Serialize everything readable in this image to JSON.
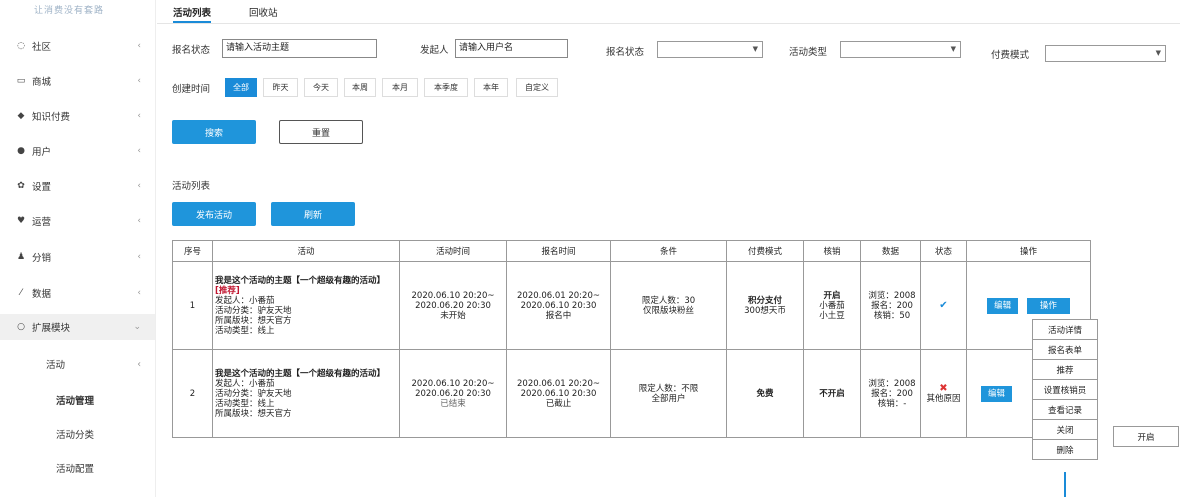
{
  "brand": {
    "logo_text": "让消费没有套路"
  },
  "sidebar": {
    "items": [
      {
        "icon": "comment-icon",
        "glyph": "◌",
        "label": "社区"
      },
      {
        "icon": "laptop-icon",
        "glyph": "▭",
        "label": "商城"
      },
      {
        "icon": "graduation-cap-icon",
        "glyph": "◆",
        "label": "知识付费"
      },
      {
        "icon": "user-icon",
        "glyph": "●",
        "label": "用户"
      },
      {
        "icon": "gear-icon",
        "glyph": "✿",
        "label": "设置"
      },
      {
        "icon": "heartbeat-icon",
        "glyph": "♥",
        "label": "运营"
      },
      {
        "icon": "users-icon",
        "glyph": "♟",
        "label": "分销"
      },
      {
        "icon": "line-chart-icon",
        "glyph": "⁄",
        "label": "数据"
      },
      {
        "icon": "extension-icon",
        "glyph": "○",
        "label": "扩展模块"
      }
    ],
    "sub_activity": "活动",
    "sub_items": [
      "活动管理",
      "活动分类",
      "活动配置"
    ]
  },
  "tabs": [
    "活动列表",
    "回收站"
  ],
  "filters": {
    "reg_status_label": "报名状态",
    "theme_value": "请输入活动主题",
    "sponsor_label": "发起人",
    "sponsor_value": "请输入用户名",
    "reg_status2_label": "报名状态",
    "type_label": "活动类型",
    "pay_label": "付费模式",
    "created_label": "创建时间",
    "time_buttons": [
      "全部",
      "昨天",
      "今天",
      "本周",
      "本月",
      "本季度",
      "本年",
      "自定义"
    ]
  },
  "buttons": {
    "search": "搜索",
    "reset": "重置",
    "publish": "发布活动",
    "refresh": "刷新"
  },
  "section_title": "活动列表",
  "table": {
    "headers": [
      "序号",
      "活动",
      "活动时间",
      "报名时间",
      "条件",
      "付费模式",
      "核销",
      "数据",
      "状态",
      "操作"
    ],
    "rows": [
      {
        "no": "1",
        "title": "我是这个活动的主题【一个超级有趣的活动】",
        "tag": "[推荐]",
        "sponsor": "发起人：小番茄",
        "category": "活动分类：驴友天地",
        "forum": "所属版块：想天官方",
        "atype": "活动类型：线上",
        "time1": "2020.06.10 20:20~",
        "time2": "2020.06.20 20:30",
        "time_status": "未开始",
        "reg1": "2020.06.01 20:20~",
        "reg2": "2020.06.10 20:30",
        "reg_status": "报名中",
        "cond1": "限定人数：30",
        "cond2": "仅限版块粉丝",
        "pay1": "积分支付",
        "pay2": "300想天币",
        "verify1": "开启",
        "verify2": "小番茄",
        "verify3": "小土豆",
        "data1": "浏览：2008",
        "data2": "报名：200",
        "data3": "核销：50",
        "state_icon": "✔",
        "state_text": "",
        "edit": "编辑",
        "ops": "操作"
      },
      {
        "no": "2",
        "title": "我是这个活动的主题【一个超级有趣的活动】",
        "sponsor": "发起人：小番茄",
        "category": "活动分类：驴友天地",
        "atype": "活动类型：线上",
        "forum": "所属版块：想天官方",
        "time1": "2020.06.10 20:20~",
        "time2": "2020.06.20 20:30",
        "time_status": "已结束",
        "reg1": "2020.06.01 20:20~",
        "reg2": "2020.06.10 20:30",
        "reg_status": "已截止",
        "cond1": "限定人数：不限",
        "cond2": "全部用户",
        "pay1": "免费",
        "verify1": "不开启",
        "data1": "浏览：2008",
        "data2": "报名：200",
        "data3": "核销：-",
        "state_icon": "✖",
        "state_text": "其他原因",
        "edit": "编辑"
      }
    ]
  },
  "dropdown": [
    "活动详情",
    "报名表单",
    "推荐",
    "设置核销员",
    "查看记录",
    "关闭",
    "删除"
  ],
  "open_button": "开启"
}
